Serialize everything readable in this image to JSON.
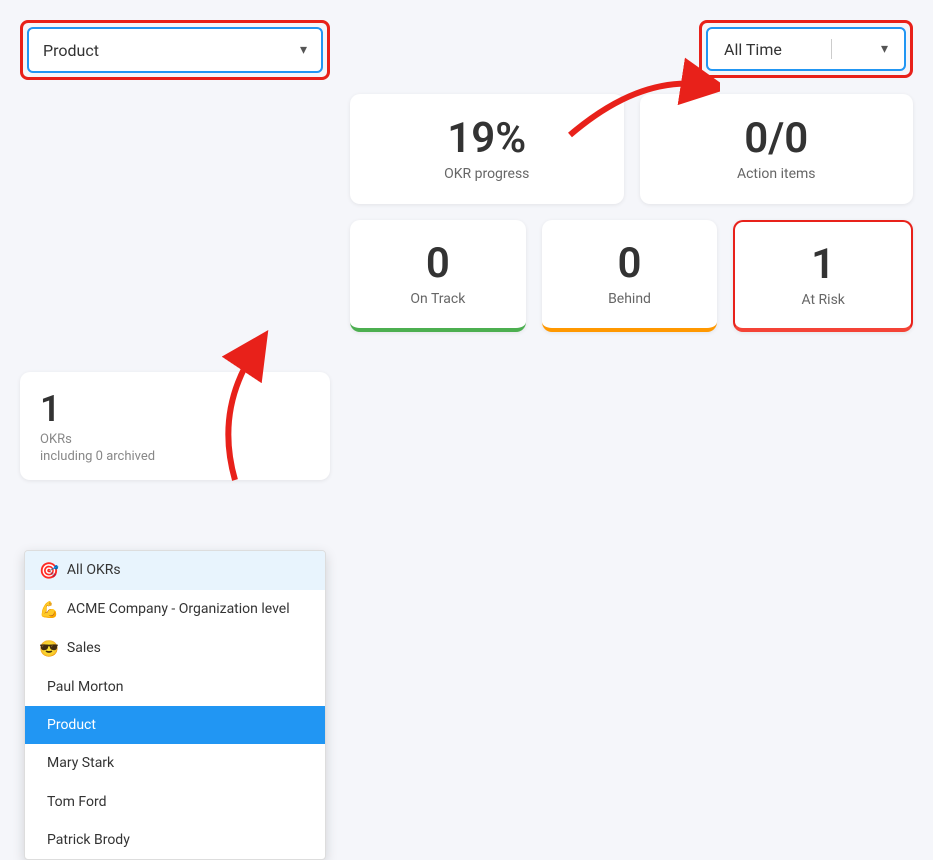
{
  "product_dropdown": {
    "selected_label": "Product",
    "chevron": "▾",
    "items": [
      {
        "id": "all-okrs",
        "icon": "🎯",
        "label": "All OKRs",
        "active": false,
        "highlighted": true
      },
      {
        "id": "acme",
        "icon": "💪",
        "label": "ACME Company - Organization level",
        "active": false,
        "highlighted": false
      },
      {
        "id": "sales",
        "icon": "😎",
        "label": "Sales",
        "active": false,
        "highlighted": false
      },
      {
        "id": "paul-morton",
        "icon": "",
        "label": "Paul Morton",
        "active": false,
        "highlighted": false
      },
      {
        "id": "product",
        "icon": "",
        "label": "Product",
        "active": true,
        "highlighted": false
      },
      {
        "id": "mary-stark",
        "icon": "",
        "label": "Mary Stark",
        "active": false,
        "highlighted": false
      },
      {
        "id": "tom-ford",
        "icon": "",
        "label": "Tom Ford",
        "active": false,
        "highlighted": false
      },
      {
        "id": "patrick-brody",
        "icon": "",
        "label": "Patrick Brody",
        "active": false,
        "highlighted": false
      }
    ]
  },
  "time_dropdown": {
    "selected_label": "All Time",
    "chevron": "▾"
  },
  "stats": {
    "okr_count": "1",
    "okr_label": "OKRs",
    "okr_sublabel": "including 0 archived",
    "okr_sublabel2": "OKRs",
    "okr_progress_value": "19%",
    "okr_progress_label": "OKR progress",
    "action_items_value": "0/0",
    "action_items_label": "Action items"
  },
  "bottom_stats": {
    "on_track_value": "0",
    "on_track_label": "On Track",
    "behind_value": "0",
    "behind_label": "Behind",
    "at_risk_value": "1",
    "at_risk_label": "At Risk"
  }
}
